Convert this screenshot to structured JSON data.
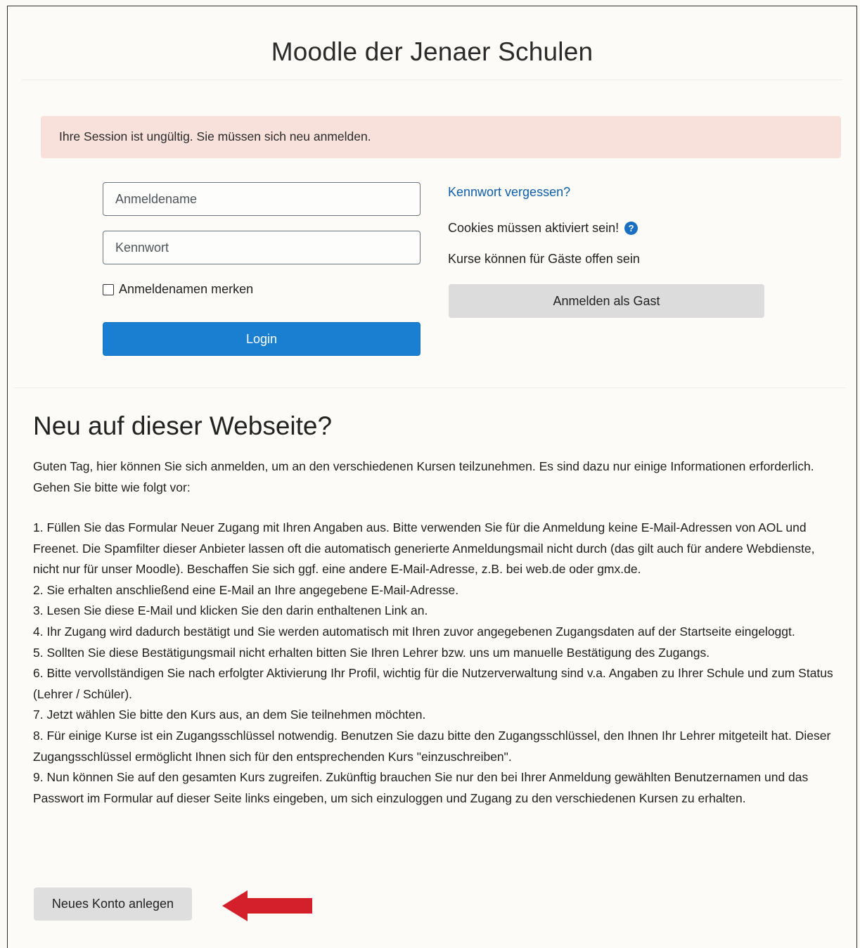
{
  "header": {
    "site_title": "Moodle der Jenaer Schulen"
  },
  "alert": {
    "message": "Ihre Session ist ungültig. Sie müssen sich neu anmelden."
  },
  "login_form": {
    "username_placeholder": "Anmeldename",
    "password_placeholder": "Kennwort",
    "remember_label": "Anmeldenamen merken",
    "remember_checked": false,
    "login_button": "Login"
  },
  "side_info": {
    "forgot_password_link": "Kennwort vergessen?",
    "cookies_notice": "Cookies müssen aktiviert sein!",
    "guest_notice": "Kurse können für Gäste offen sein",
    "guest_button": "Anmelden als Gast"
  },
  "signup": {
    "heading": "Neu auf dieser Webseite?",
    "intro": "Guten Tag, hier können Sie sich anmelden, um an den verschiedenen Kursen teilzunehmen. Es sind dazu nur einige Informationen erforderlich. Gehen Sie bitte wie folgt vor:",
    "steps": [
      "1. Füllen Sie das Formular Neuer Zugang mit Ihren Angaben aus. Bitte verwenden Sie für die Anmeldung keine E-Mail-Adressen von AOL und Freenet. Die Spamfilter dieser Anbieter lassen oft die automatisch generierte Anmeldungsmail nicht durch (das gilt auch für andere Webdienste, nicht nur für unser Moodle). Beschaffen Sie sich ggf. eine andere E-Mail-Adresse, z.B. bei web.de oder gmx.de.",
      "2. Sie erhalten anschließend eine E-Mail an Ihre angegebene E-Mail-Adresse.",
      "3. Lesen Sie diese E-Mail und klicken Sie den darin enthaltenen Link an.",
      "4. Ihr Zugang wird dadurch bestätigt und Sie werden automatisch mit Ihren zuvor angegebenen Zugangsdaten auf der Startseite eingeloggt.",
      "5. Sollten Sie diese Bestätigungsmail nicht erhalten bitten Sie Ihren Lehrer bzw. uns um manuelle Bestätigung des Zugangs.",
      "6. Bitte vervollständigen Sie nach erfolgter Aktivierung Ihr Profil, wichtig für die Nutzerverwaltung sind v.a. Angaben zu Ihrer Schule und zum Status (Lehrer / Schüler).",
      "7. Jetzt wählen Sie bitte den Kurs aus, an dem Sie teilnehmen möchten.",
      "8. Für einige Kurse ist ein Zugangsschlüssel notwendig. Benutzen Sie dazu bitte den Zugangsschlüssel, den Ihnen Ihr Lehrer mitgeteilt hat. Dieser Zugangsschlüssel ermöglicht Ihnen sich für den entsprechenden Kurs \"einzuschreiben\".",
      "9. Nun können Sie auf den gesamten Kurs zugreifen. Zukünftig brauchen Sie nur den bei Ihrer Anmeldung gewählten Benutzernamen und das Passwort im Formular auf dieser Seite links eingeben, um sich einzuloggen und Zugang zu den verschiedenen Kursen zu erhalten."
    ],
    "new_account_button": "Neues Konto anlegen"
  },
  "colors": {
    "primary": "#1a7fd1",
    "alert_bg": "#f8e1da",
    "link": "#0f5fa8",
    "arrow": "#d3202a"
  },
  "icons": {
    "help": "question-circle-icon",
    "annotation": "red-arrow-left-icon"
  }
}
